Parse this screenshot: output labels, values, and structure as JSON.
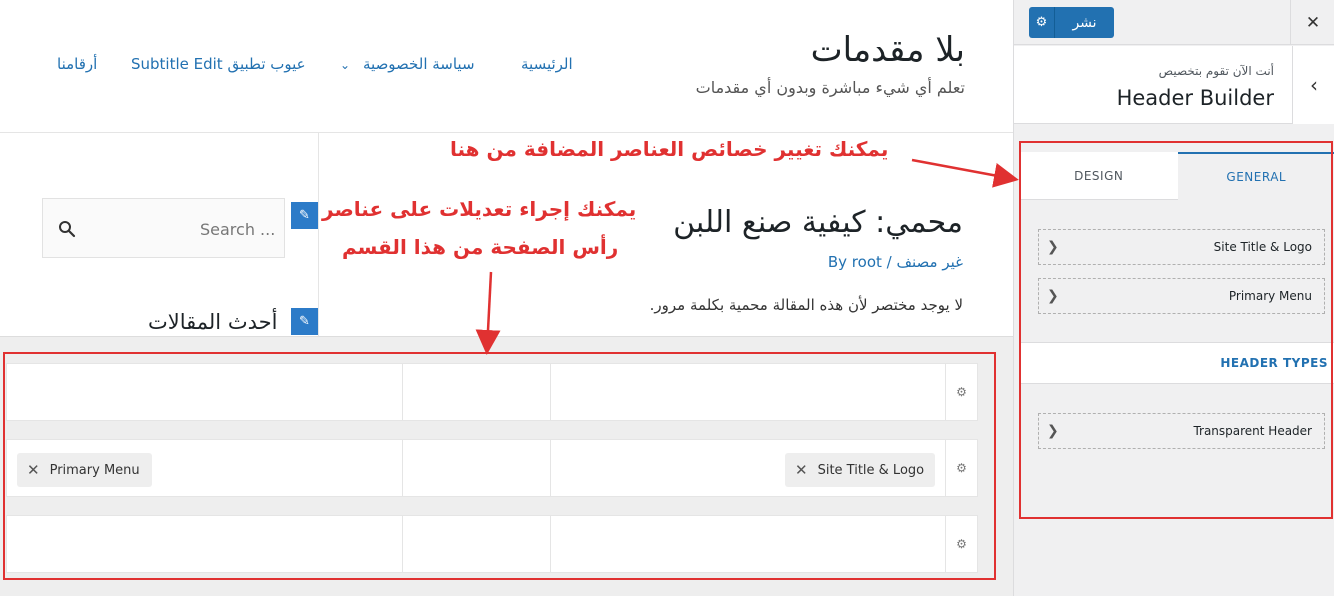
{
  "site": {
    "title": "بلا مقدمات",
    "tagline": "تعلم أي شيء مباشرة وبدون أي مقدمات"
  },
  "nav": {
    "items": [
      {
        "label": "الرئيسية"
      },
      {
        "label": "سياسة الخصوصية"
      },
      {
        "label": "عيوب تطبيق Subtitle Edit"
      },
      {
        "label": "أرقامنا"
      }
    ]
  },
  "sidebar_widget": {
    "search_placeholder": "Search ...",
    "widget_title": "أحدث المقالات"
  },
  "post": {
    "title": "محمي: كيفية صنع اللبن",
    "meta_category": "غير مصنف",
    "meta_sep": " / ",
    "meta_author": "By root",
    "excerpt": "لا يوجد مختصر لأن هذه المقالة محمية بكلمة مرور."
  },
  "annotations": {
    "panel_note": "يمكنك تغيير خصائص العناصر المضافة من هنا",
    "builder_note_line1": "يمكنك إجراء تعديلات على عناصر",
    "builder_note_line2": "رأس الصفحة من هذا القسم",
    "color": "#e03131"
  },
  "builder": {
    "rows": [
      {
        "left_chip": "",
        "right_chip": ""
      },
      {
        "left_chip": "Primary Menu",
        "right_chip": "Site Title & Logo"
      },
      {
        "left_chip": "",
        "right_chip": ""
      }
    ],
    "chip_remove_icon": "✕",
    "row_settings_icon": "gear-icon"
  },
  "panel": {
    "close_icon": "✕",
    "publish_label": "نشر",
    "section_subtitle": "أنت الآن تقوم بتخصيص",
    "section_title": "Header Builder",
    "tabs": {
      "design": "DESIGN",
      "general": "GENERAL"
    },
    "general_items": [
      "Site Title & Logo",
      "Primary Menu"
    ],
    "header_types_label": "HEADER TYPES",
    "header_type_items": [
      "Transparent Header"
    ],
    "accent": "#2271b1"
  }
}
